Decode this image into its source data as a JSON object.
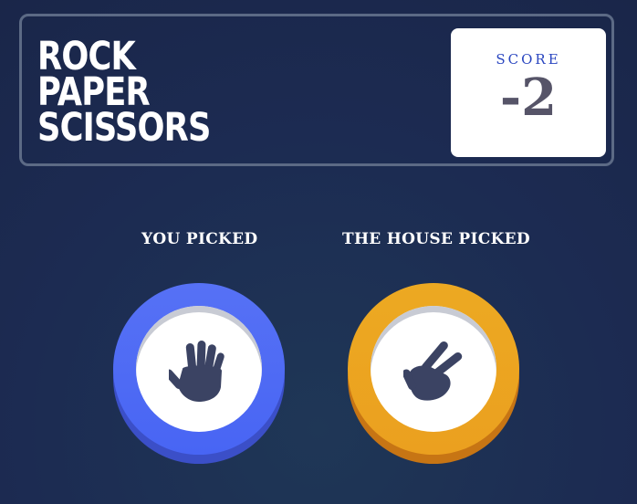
{
  "header": {
    "title_lines": [
      "ROCK",
      "PAPER",
      "SCISSORS"
    ]
  },
  "score": {
    "label": "SCORE",
    "value": "-2"
  },
  "result": {
    "player_label": "YOU PICKED",
    "house_label": "THE HOUSE PICKED",
    "player_pick": "paper",
    "house_pick": "scissors"
  },
  "icons": {
    "player_icon": "paper-hand-icon",
    "house_icon": "scissors-hand-icon"
  },
  "colors": {
    "paper": "#4865f4",
    "scissors": "#eca922",
    "icon": "#3b4363",
    "score_label": "#2a46c0",
    "score_value": "#565468"
  }
}
